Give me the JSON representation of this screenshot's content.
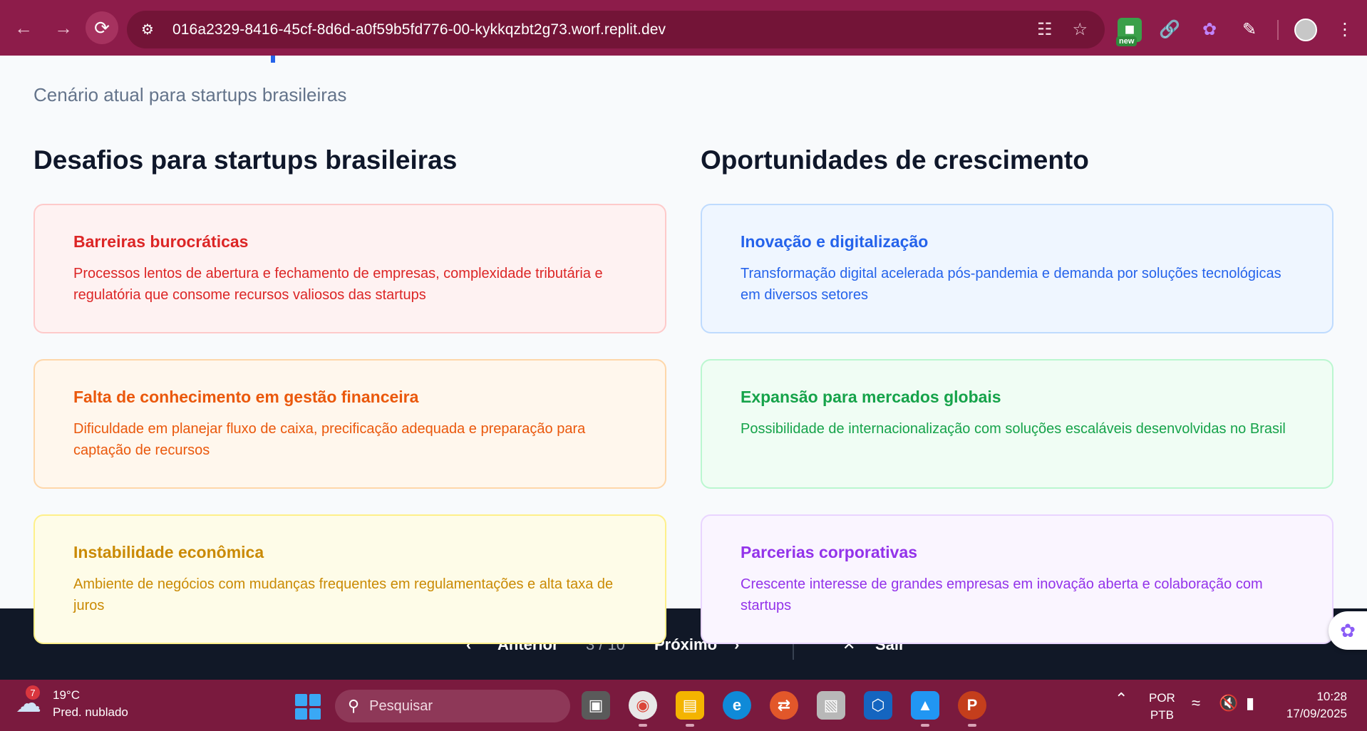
{
  "browser": {
    "url": "016a2329-8416-45cf-8d6d-a0f59b5fd776-00-kykkqzbt2g73.worf.replit.dev",
    "new_badge": "new"
  },
  "slide": {
    "subtitle": "Cenário atual para startups brasileiras",
    "challenges": {
      "heading": "Desafios para startups brasileiras",
      "items": [
        {
          "title": "Barreiras burocráticas",
          "text": "Processos lentos de abertura e fechamento de empresas, complexidade tributária e regulatória que consome recursos valiosos das startups"
        },
        {
          "title": "Falta de conhecimento em gestão financeira",
          "text": "Dificuldade em planejar fluxo de caixa, precificação adequada e preparação para captação de recursos"
        },
        {
          "title": "Instabilidade econômica",
          "text": "Ambiente de negócios com mudanças frequentes em regulamentações e alta taxa de juros"
        }
      ]
    },
    "opportunities": {
      "heading": "Oportunidades de crescimento",
      "items": [
        {
          "title": "Inovação e digitalização",
          "text": "Transformação digital acelerada pós-pandemia e demanda por soluções tecnológicas em diversos setores"
        },
        {
          "title": "Expansão para mercados globais",
          "text": "Possibilidade de internacionalização com soluções escaláveis desenvolvidas no Brasil"
        },
        {
          "title": "Parcerias corporativas",
          "text": "Crescente interesse de grandes empresas em inovação aberta e colaboração com startups"
        }
      ]
    },
    "colors": {
      "red": "#dc2626",
      "orange": "#ea580c",
      "yellow": "#ca8a04",
      "blue": "#2563eb",
      "green": "#16a34a",
      "purple": "#9333ea"
    }
  },
  "presentation_nav": {
    "prev_label": "Anterior",
    "counter": "3 / 10",
    "next_label": "Próximo",
    "exit_label": "Sair"
  },
  "taskbar": {
    "weather_badge": "7",
    "temperature": "19°C",
    "weather_desc": "Pred. nublado",
    "search_placeholder": "Pesquisar",
    "language": "POR",
    "keyboard": "PTB",
    "time": "10:28",
    "date": "17/09/2025"
  }
}
